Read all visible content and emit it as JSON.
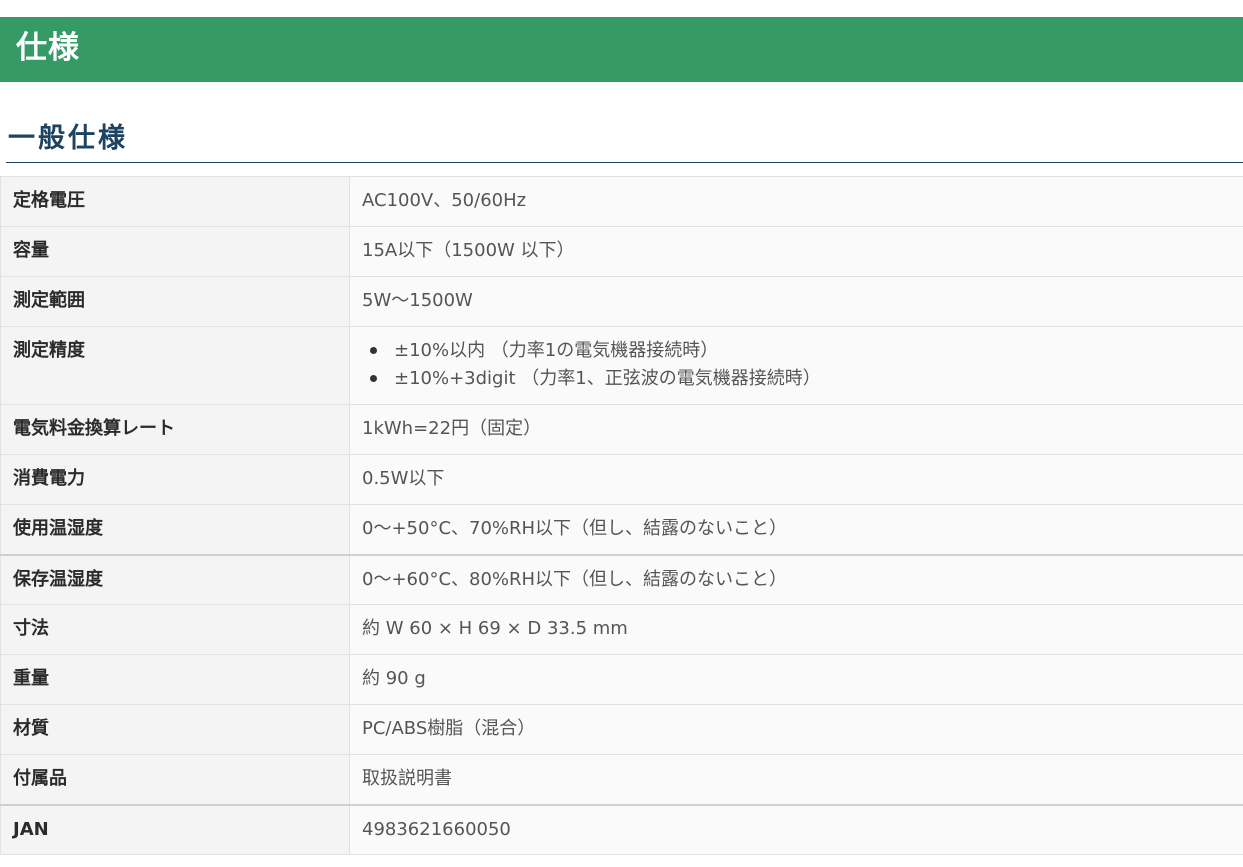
{
  "header": {
    "title": "仕様"
  },
  "section": {
    "title": "一般仕様"
  },
  "specs": [
    {
      "label": "定格電圧",
      "value": "AC100V、50/60Hz"
    },
    {
      "label": "容量",
      "value": "15A以下（1500W 以下）"
    },
    {
      "label": "測定範囲",
      "value": "5W〜1500W"
    },
    {
      "label": "測定精度",
      "items": [
        "±10%以内 （力率1の電気機器接続時）",
        "±10%+3digit （力率1、正弦波の電気機器接続時）"
      ]
    },
    {
      "label": "電気料金換算レート",
      "value": "1kWh=22円（固定）"
    },
    {
      "label": "消費電力",
      "value": "0.5W以下"
    },
    {
      "label": "使用温湿度",
      "value": "0〜+50°C、70%RH以下（但し、結露のないこと）"
    },
    {
      "label": "保存温湿度",
      "value": "0〜+60°C、80%RH以下（但し、結露のないこと）"
    },
    {
      "label": "寸法",
      "value": "約 W 60 × H 69 × D 33.5 mm"
    },
    {
      "label": "重量",
      "value": "約 90 g"
    },
    {
      "label": "材質",
      "value": "PC/ABS樹脂（混合）"
    },
    {
      "label": "付属品",
      "value": "取扱説明書"
    },
    {
      "label": "JAN",
      "value": "4983621660050"
    }
  ],
  "colors": {
    "header_bg": "#359a66",
    "header_text": "#ffffff",
    "subtitle_text": "#1d4363",
    "label_bg": "#f4f4f4",
    "value_bg": "#fafafa",
    "border": "#e2e2e2"
  }
}
